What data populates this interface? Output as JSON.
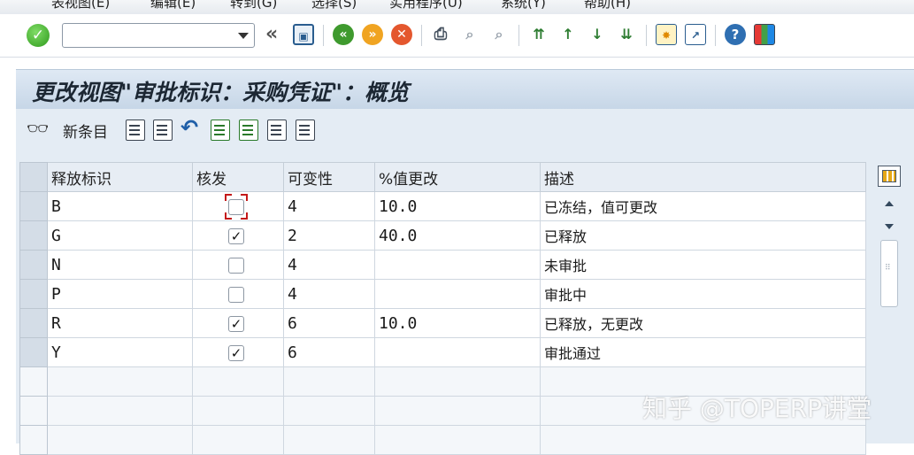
{
  "menubar": {
    "items": [
      "表视图(E)",
      "编辑(E)",
      "转到(G)",
      "选择(S)",
      "实用程序(U)",
      "系统(Y)",
      "帮助(H)"
    ]
  },
  "toolbar": {
    "command_field_value": "",
    "icons": [
      "enter-icon",
      "save-icon",
      "back-icon",
      "exit-icon",
      "cancel-icon",
      "print-icon",
      "find-icon",
      "find-next-icon",
      "first-page-icon",
      "previous-page-icon",
      "next-page-icon",
      "last-page-icon",
      "create-session-icon",
      "shortcut-icon",
      "help-icon",
      "layout-icon"
    ]
  },
  "title": "更改视图\"审批标识：采购凭证\"：概览",
  "app_toolbar": {
    "new_entries_label": "新条目"
  },
  "table": {
    "columns": [
      "释放标识",
      "核发",
      "可变性",
      "%值更改",
      "描述"
    ],
    "rows": [
      {
        "code": "B",
        "release": false,
        "variability": "4",
        "pct": "10.0",
        "desc": "已冻结，值可更改"
      },
      {
        "code": "G",
        "release": true,
        "variability": "2",
        "pct": "40.0",
        "desc": "已释放"
      },
      {
        "code": "N",
        "release": false,
        "variability": "4",
        "pct": "",
        "desc": "未审批"
      },
      {
        "code": "P",
        "release": false,
        "variability": "4",
        "pct": "",
        "desc": "审批中"
      },
      {
        "code": "R",
        "release": true,
        "variability": "6",
        "pct": "10.0",
        "desc": "已释放，无更改"
      },
      {
        "code": "Y",
        "release": true,
        "variability": "6",
        "pct": "",
        "desc": "审批通过"
      }
    ],
    "empty_rows": 3
  },
  "watermark": "知乎 @TOPERP讲堂",
  "colors": {
    "title_bg": "#c6d6e7",
    "toolbar_bg": "#e4ecf4",
    "focus": "#c41919"
  }
}
